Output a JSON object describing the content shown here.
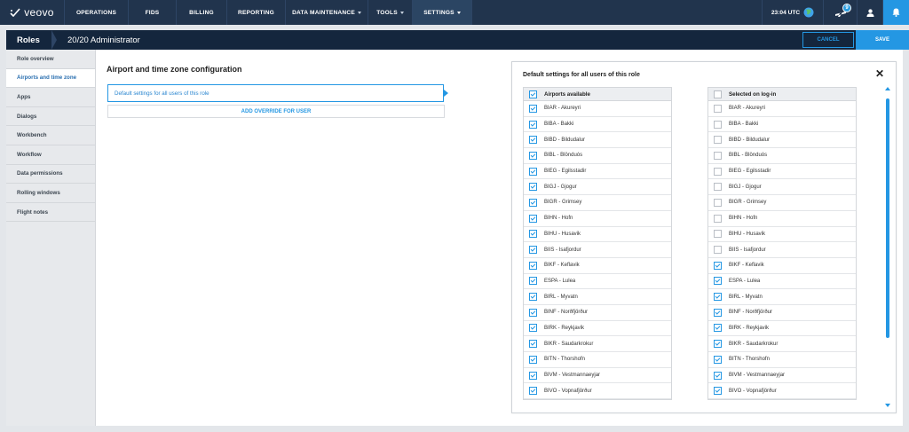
{
  "app": {
    "logo_text": "veovo"
  },
  "nav": {
    "items": [
      {
        "label": "OPERATIONS",
        "dropdown": false,
        "active": false
      },
      {
        "label": "FIDS",
        "dropdown": false,
        "active": false
      },
      {
        "label": "BILLING",
        "dropdown": false,
        "active": false
      },
      {
        "label": "REPORTING",
        "dropdown": false,
        "active": false
      },
      {
        "label": "DATA MAINTENANCE",
        "dropdown": true,
        "active": false
      },
      {
        "label": "TOOLS",
        "dropdown": true,
        "active": false
      },
      {
        "label": "SETTINGS",
        "dropdown": true,
        "active": true
      }
    ],
    "time": "23:04 UTC",
    "flights_badge": "9"
  },
  "subheader": {
    "section": "Roles",
    "role_name": "20/20 Administrator",
    "cancel_label": "CANCEL",
    "save_label": "SAVE"
  },
  "sidebar": {
    "items": [
      {
        "label": "Role overview",
        "active": false
      },
      {
        "label": "Airports and time zone",
        "active": true
      },
      {
        "label": "Apps",
        "active": false
      },
      {
        "label": "Dialogs",
        "active": false
      },
      {
        "label": "Workbench",
        "active": false
      },
      {
        "label": "Workflow",
        "active": false
      },
      {
        "label": "Data permissions",
        "active": false
      },
      {
        "label": "Rolling windows",
        "active": false
      },
      {
        "label": "Flight notes",
        "active": false
      }
    ]
  },
  "main": {
    "title": "Airport and time zone configuration",
    "default_label": "Default settings for all users of this role",
    "override_label": "ADD OVERRIDE FOR USER"
  },
  "panel": {
    "title": "Default settings for all users of this role",
    "close_label": "✕",
    "available_header": "Airports available",
    "available_header_checked": true,
    "selected_header": "Selected on log-in",
    "selected_header_checked": false,
    "airports": [
      {
        "name": "BIAR - Akureyri",
        "available": true,
        "selected": false
      },
      {
        "name": "BIBA - Bakki",
        "available": true,
        "selected": false
      },
      {
        "name": "BIBD - Bildudalur",
        "available": true,
        "selected": false
      },
      {
        "name": "BIBL - Blönduós",
        "available": true,
        "selected": false
      },
      {
        "name": "BIEG - Egilsstadir",
        "available": true,
        "selected": false
      },
      {
        "name": "BIGJ - Gjogur",
        "available": true,
        "selected": false
      },
      {
        "name": "BIGR - Grimsey",
        "available": true,
        "selected": false
      },
      {
        "name": "BIHN - Hofn",
        "available": true,
        "selected": false
      },
      {
        "name": "BIHU - Husavik",
        "available": true,
        "selected": false
      },
      {
        "name": "BIIS - Isafjordur",
        "available": true,
        "selected": false
      },
      {
        "name": "BIKF - Keflavik",
        "available": true,
        "selected": true
      },
      {
        "name": "ESPA - Lulea",
        "available": true,
        "selected": true
      },
      {
        "name": "BIRL - Myvatn",
        "available": true,
        "selected": true
      },
      {
        "name": "BINF - Norðfjörður",
        "available": true,
        "selected": true
      },
      {
        "name": "BIRK - Reykjavik",
        "available": true,
        "selected": true
      },
      {
        "name": "BIKR - Saudarkrokur",
        "available": true,
        "selected": true
      },
      {
        "name": "BITN - Thorshofn",
        "available": true,
        "selected": true
      },
      {
        "name": "BIVM - Vestmannaeyjar",
        "available": true,
        "selected": true
      },
      {
        "name": "BIVO - Vopnafjörður",
        "available": true,
        "selected": true
      }
    ]
  },
  "colors": {
    "accent": "#2497e3",
    "topbar": "#21344d",
    "subbar": "#14263d"
  }
}
